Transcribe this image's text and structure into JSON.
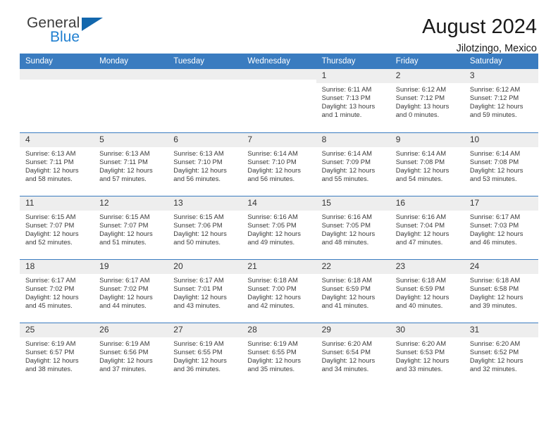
{
  "brand": {
    "name_top": "General",
    "name_bottom": "Blue",
    "flag_icon": "triangle-flag-icon",
    "accent_color": "#1267ad",
    "blue_text_color": "#1f7fd0"
  },
  "header": {
    "title": "August 2024",
    "location": "Jilotzingo, Mexico"
  },
  "calendar": {
    "header_bg": "#3a7cc0",
    "daynum_bg": "#eeeeee",
    "weekdays": [
      "Sunday",
      "Monday",
      "Tuesday",
      "Wednesday",
      "Thursday",
      "Friday",
      "Saturday"
    ],
    "labels": {
      "sunrise": "Sunrise:",
      "sunset": "Sunset:",
      "daylight": "Daylight:"
    },
    "weeks": [
      [
        {
          "day": "",
          "empty": true
        },
        {
          "day": "",
          "empty": true
        },
        {
          "day": "",
          "empty": true
        },
        {
          "day": "",
          "empty": true
        },
        {
          "day": "1",
          "sunrise": "Sunrise: 6:11 AM",
          "sunset": "Sunset: 7:13 PM",
          "daylight1": "Daylight: 13 hours",
          "daylight2": "and 1 minute."
        },
        {
          "day": "2",
          "sunrise": "Sunrise: 6:12 AM",
          "sunset": "Sunset: 7:12 PM",
          "daylight1": "Daylight: 13 hours",
          "daylight2": "and 0 minutes."
        },
        {
          "day": "3",
          "sunrise": "Sunrise: 6:12 AM",
          "sunset": "Sunset: 7:12 PM",
          "daylight1": "Daylight: 12 hours",
          "daylight2": "and 59 minutes."
        }
      ],
      [
        {
          "day": "4",
          "sunrise": "Sunrise: 6:13 AM",
          "sunset": "Sunset: 7:11 PM",
          "daylight1": "Daylight: 12 hours",
          "daylight2": "and 58 minutes."
        },
        {
          "day": "5",
          "sunrise": "Sunrise: 6:13 AM",
          "sunset": "Sunset: 7:11 PM",
          "daylight1": "Daylight: 12 hours",
          "daylight2": "and 57 minutes."
        },
        {
          "day": "6",
          "sunrise": "Sunrise: 6:13 AM",
          "sunset": "Sunset: 7:10 PM",
          "daylight1": "Daylight: 12 hours",
          "daylight2": "and 56 minutes."
        },
        {
          "day": "7",
          "sunrise": "Sunrise: 6:14 AM",
          "sunset": "Sunset: 7:10 PM",
          "daylight1": "Daylight: 12 hours",
          "daylight2": "and 56 minutes."
        },
        {
          "day": "8",
          "sunrise": "Sunrise: 6:14 AM",
          "sunset": "Sunset: 7:09 PM",
          "daylight1": "Daylight: 12 hours",
          "daylight2": "and 55 minutes."
        },
        {
          "day": "9",
          "sunrise": "Sunrise: 6:14 AM",
          "sunset": "Sunset: 7:08 PM",
          "daylight1": "Daylight: 12 hours",
          "daylight2": "and 54 minutes."
        },
        {
          "day": "10",
          "sunrise": "Sunrise: 6:14 AM",
          "sunset": "Sunset: 7:08 PM",
          "daylight1": "Daylight: 12 hours",
          "daylight2": "and 53 minutes."
        }
      ],
      [
        {
          "day": "11",
          "sunrise": "Sunrise: 6:15 AM",
          "sunset": "Sunset: 7:07 PM",
          "daylight1": "Daylight: 12 hours",
          "daylight2": "and 52 minutes."
        },
        {
          "day": "12",
          "sunrise": "Sunrise: 6:15 AM",
          "sunset": "Sunset: 7:07 PM",
          "daylight1": "Daylight: 12 hours",
          "daylight2": "and 51 minutes."
        },
        {
          "day": "13",
          "sunrise": "Sunrise: 6:15 AM",
          "sunset": "Sunset: 7:06 PM",
          "daylight1": "Daylight: 12 hours",
          "daylight2": "and 50 minutes."
        },
        {
          "day": "14",
          "sunrise": "Sunrise: 6:16 AM",
          "sunset": "Sunset: 7:05 PM",
          "daylight1": "Daylight: 12 hours",
          "daylight2": "and 49 minutes."
        },
        {
          "day": "15",
          "sunrise": "Sunrise: 6:16 AM",
          "sunset": "Sunset: 7:05 PM",
          "daylight1": "Daylight: 12 hours",
          "daylight2": "and 48 minutes."
        },
        {
          "day": "16",
          "sunrise": "Sunrise: 6:16 AM",
          "sunset": "Sunset: 7:04 PM",
          "daylight1": "Daylight: 12 hours",
          "daylight2": "and 47 minutes."
        },
        {
          "day": "17",
          "sunrise": "Sunrise: 6:17 AM",
          "sunset": "Sunset: 7:03 PM",
          "daylight1": "Daylight: 12 hours",
          "daylight2": "and 46 minutes."
        }
      ],
      [
        {
          "day": "18",
          "sunrise": "Sunrise: 6:17 AM",
          "sunset": "Sunset: 7:02 PM",
          "daylight1": "Daylight: 12 hours",
          "daylight2": "and 45 minutes."
        },
        {
          "day": "19",
          "sunrise": "Sunrise: 6:17 AM",
          "sunset": "Sunset: 7:02 PM",
          "daylight1": "Daylight: 12 hours",
          "daylight2": "and 44 minutes."
        },
        {
          "day": "20",
          "sunrise": "Sunrise: 6:17 AM",
          "sunset": "Sunset: 7:01 PM",
          "daylight1": "Daylight: 12 hours",
          "daylight2": "and 43 minutes."
        },
        {
          "day": "21",
          "sunrise": "Sunrise: 6:18 AM",
          "sunset": "Sunset: 7:00 PM",
          "daylight1": "Daylight: 12 hours",
          "daylight2": "and 42 minutes."
        },
        {
          "day": "22",
          "sunrise": "Sunrise: 6:18 AM",
          "sunset": "Sunset: 6:59 PM",
          "daylight1": "Daylight: 12 hours",
          "daylight2": "and 41 minutes."
        },
        {
          "day": "23",
          "sunrise": "Sunrise: 6:18 AM",
          "sunset": "Sunset: 6:59 PM",
          "daylight1": "Daylight: 12 hours",
          "daylight2": "and 40 minutes."
        },
        {
          "day": "24",
          "sunrise": "Sunrise: 6:18 AM",
          "sunset": "Sunset: 6:58 PM",
          "daylight1": "Daylight: 12 hours",
          "daylight2": "and 39 minutes."
        }
      ],
      [
        {
          "day": "25",
          "sunrise": "Sunrise: 6:19 AM",
          "sunset": "Sunset: 6:57 PM",
          "daylight1": "Daylight: 12 hours",
          "daylight2": "and 38 minutes."
        },
        {
          "day": "26",
          "sunrise": "Sunrise: 6:19 AM",
          "sunset": "Sunset: 6:56 PM",
          "daylight1": "Daylight: 12 hours",
          "daylight2": "and 37 minutes."
        },
        {
          "day": "27",
          "sunrise": "Sunrise: 6:19 AM",
          "sunset": "Sunset: 6:55 PM",
          "daylight1": "Daylight: 12 hours",
          "daylight2": "and 36 minutes."
        },
        {
          "day": "28",
          "sunrise": "Sunrise: 6:19 AM",
          "sunset": "Sunset: 6:55 PM",
          "daylight1": "Daylight: 12 hours",
          "daylight2": "and 35 minutes."
        },
        {
          "day": "29",
          "sunrise": "Sunrise: 6:20 AM",
          "sunset": "Sunset: 6:54 PM",
          "daylight1": "Daylight: 12 hours",
          "daylight2": "and 34 minutes."
        },
        {
          "day": "30",
          "sunrise": "Sunrise: 6:20 AM",
          "sunset": "Sunset: 6:53 PM",
          "daylight1": "Daylight: 12 hours",
          "daylight2": "and 33 minutes."
        },
        {
          "day": "31",
          "sunrise": "Sunrise: 6:20 AM",
          "sunset": "Sunset: 6:52 PM",
          "daylight1": "Daylight: 12 hours",
          "daylight2": "and 32 minutes."
        }
      ]
    ]
  }
}
